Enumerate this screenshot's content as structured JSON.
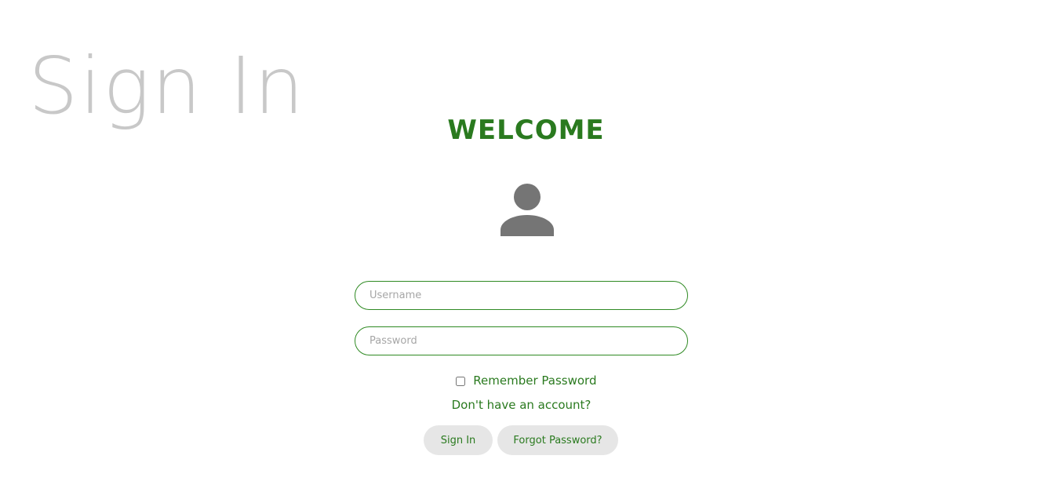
{
  "page": {
    "background_title": "Sign In",
    "heading": "WELCOME"
  },
  "avatar": {
    "icon": "user-icon",
    "color": "#757575"
  },
  "form": {
    "username_placeholder": "Username",
    "username_value": "",
    "password_placeholder": "Password",
    "password_value": "",
    "remember_label": "Remember Password",
    "remember_checked": false,
    "signup_link": "Don't have an account?",
    "signin_button": "Sign In",
    "forgot_button": "Forgot Password?"
  },
  "colors": {
    "accent": "#2a7a1f",
    "border": "#2f8a23",
    "button_bg": "#e6e6e6",
    "title_gray": "#c8c8c8"
  }
}
